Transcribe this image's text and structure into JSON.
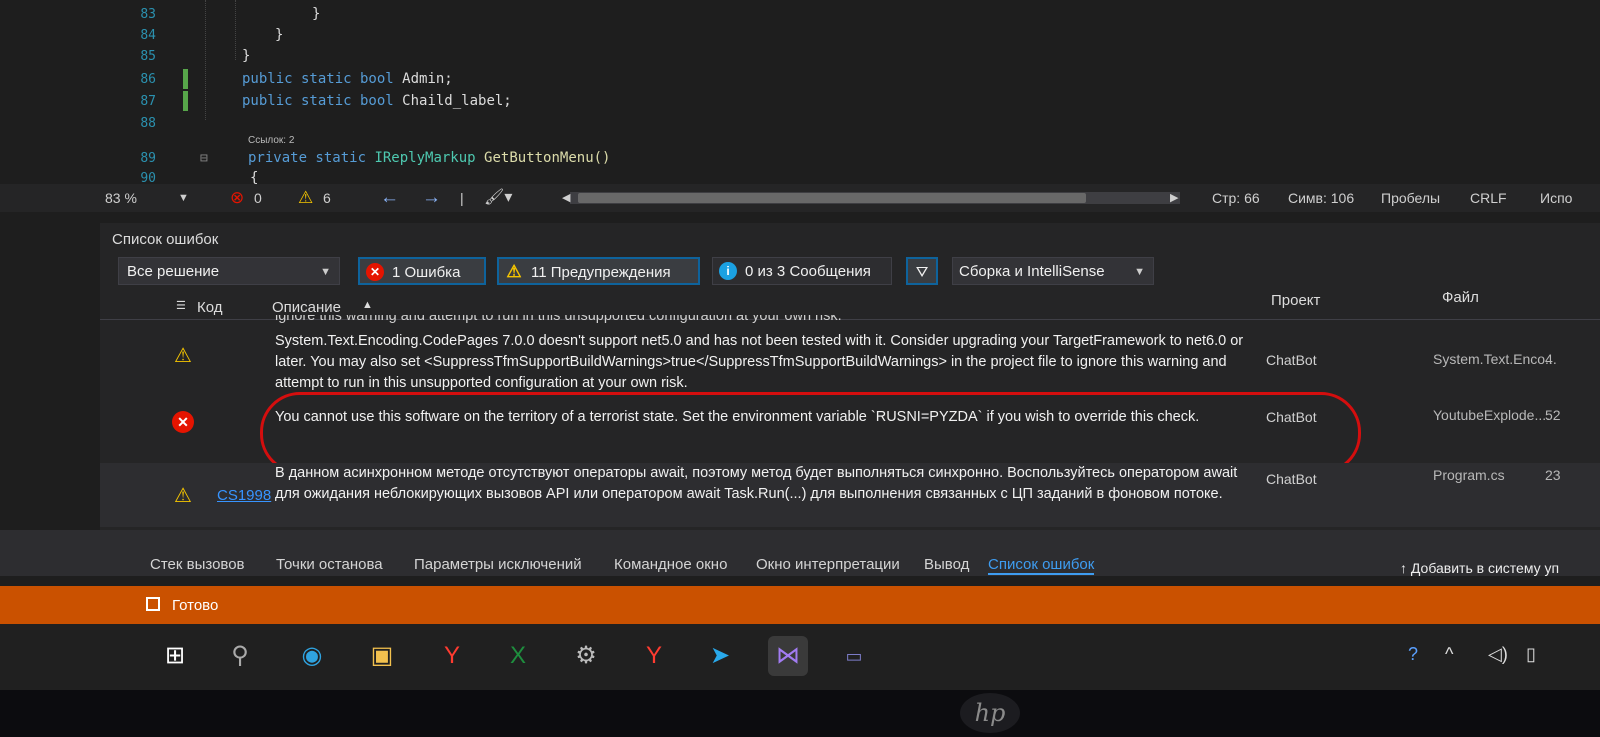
{
  "editor": {
    "lines": [
      {
        "no": "83",
        "code": "}"
      },
      {
        "no": "84",
        "code": "}"
      },
      {
        "no": "85",
        "code": "}"
      },
      {
        "no": "86",
        "kw": "public static bool",
        "name": "Admin;"
      },
      {
        "no": "87",
        "kw": "public static bool",
        "name": "Chaild_label;"
      },
      {
        "no": "88",
        "code": ""
      },
      {
        "no": "89",
        "kw": "private static",
        "type": "IReplyMarkup",
        "name": "GetButtonMenu()"
      },
      {
        "no": "90",
        "code": "{"
      }
    ],
    "codelens": "Ссылок: 2"
  },
  "editor_status": {
    "zoom": "83 %",
    "errors": "0",
    "warnings": "6",
    "line": "Стр: 66",
    "col": "Симв: 106",
    "indent": "Пробелы",
    "eol": "CRLF",
    "mode": "Испо"
  },
  "error_list": {
    "title": "Список ошибок",
    "scope": "Все решение",
    "errors_btn": "1 Ошибка",
    "warnings_btn": "11 Предупреждения",
    "messages_btn": "0 из 3 Сообщения",
    "build_filter": "Сборка и IntelliSense",
    "columns": {
      "code": "Код",
      "description": "Описание",
      "project": "Проект",
      "file": "Файл"
    },
    "partial_top": "ignore this warning and attempt to run in this unsupported configuration at your own risk.",
    "rows": [
      {
        "icon": "warning-icon",
        "code": "",
        "description": "System.Text.Encoding.CodePages 7.0.0 doesn't support net5.0 and has not been tested with it. Consider upgrading your TargetFramework to net6.0 or later. You may also set <SuppressTfmSupportBuildWarnings>true</SuppressTfmSupportBuildWarnings> in the project file to ignore this warning and attempt to run in this unsupported configuration at your own risk.",
        "project": "ChatBot",
        "file": "System.Text.Enco...",
        "line": "4"
      },
      {
        "icon": "error-icon",
        "code": "",
        "description": "You cannot use this software on the territory of a terrorist state. Set the environment variable `RUSNI=PYZDA` if you wish to override this check.",
        "project": "ChatBot",
        "file": "YoutubeExplode....",
        "line": "52"
      },
      {
        "icon": "warning-icon",
        "code": "CS1998",
        "description": "В данном асинхронном методе отсутствуют операторы await, поэтому метод будет выполняться синхронно. Воспользуйтесь оператором await для ожидания неблокирующих вызовов API или оператором await Task.Run(...) для выполнения связанных с ЦП заданий в фоновом потоке.",
        "project": "ChatBot",
        "file": "Program.cs",
        "line": "23"
      }
    ]
  },
  "bottom_tabs": [
    "Стек вызовов",
    "Точки останова",
    "Параметры исключений",
    "Командное окно",
    "Окно интерпретации",
    "Вывод",
    "Список ошибок"
  ],
  "status_bar": {
    "ready": "Готово",
    "source_control": "Добавить в систему уп"
  },
  "brand": "hp"
}
